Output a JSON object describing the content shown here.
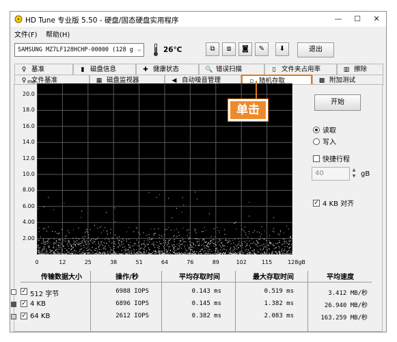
{
  "window": {
    "title": "HD Tune 专业版 5.50 - 硬盘/固态硬盘实用程序",
    "minimize": "—",
    "maximize": "☐",
    "close": "✕"
  },
  "menu": [
    {
      "label": "文件(F)"
    },
    {
      "label": "帮助(H)"
    }
  ],
  "toolbar": {
    "drive": "SAMSUNG MZ7LF128HCHP-00000 (128 g",
    "temperature": "26℃",
    "exit_label": "退出"
  },
  "tabs_top": [
    {
      "label": "基准",
      "icon": "♀"
    },
    {
      "label": "磁盘信息",
      "icon": "▮"
    },
    {
      "label": "健康状态",
      "icon": "✚"
    },
    {
      "label": "错误扫描",
      "icon": "🔍"
    },
    {
      "label": "文件夹占用率",
      "icon": "▯"
    },
    {
      "label": "擦除",
      "icon": "▥"
    }
  ],
  "tabs_bottom": [
    {
      "label": "文件基准",
      "icon": "♀"
    },
    {
      "label": "磁盘监视器",
      "icon": "▦"
    },
    {
      "label": "自动噪音管理",
      "icon": "◀"
    },
    {
      "label": "随机存取",
      "icon": "▫"
    },
    {
      "label": "附加测试",
      "icon": "▩"
    }
  ],
  "callout": "单击",
  "chart_data": {
    "type": "scatter",
    "ylabel": "ms",
    "y_ticks": [
      "20.0",
      "18.0",
      "16.0",
      "14.0",
      "12.0",
      "10.0",
      "8.00",
      "6.00",
      "4.00",
      "2.00"
    ],
    "x_ticks": [
      "0",
      "12",
      "25",
      "38",
      "51",
      "64",
      "76",
      "89",
      "102",
      "115",
      "128gB"
    ],
    "ylim": [
      0,
      20
    ],
    "xlim": [
      0,
      128
    ],
    "grid": true,
    "series": [
      {
        "values": "dense cluster of access times 0.1–2.0 ms, sparse points up to 8 ms",
        "color": "#ffffff"
      }
    ]
  },
  "controls": {
    "start_label": "开始",
    "read_label": "读取",
    "write_label": "写入",
    "read_selected": true,
    "quick_label": "快捷行程",
    "quick_checked": false,
    "quick_value": "40",
    "quick_unit": "gB",
    "align_label": "4 KB 对齐",
    "align_checked": true
  },
  "table": {
    "headers": [
      "传输数据大小",
      "操作/秒",
      "平均存取时间",
      "最大存取时间",
      "平均速度"
    ],
    "rows": [
      {
        "size": "512 字节",
        "iops": "6988 IOPS",
        "avg": "0.143 ms",
        "max": "0.519 ms",
        "speed": "3.412 MB/秒",
        "legend_color": "#ffffff"
      },
      {
        "size": "4 KB",
        "iops": "6896 IOPS",
        "avg": "0.145 ms",
        "max": "1.382 ms",
        "speed": "26.940 MB/秒",
        "legend_color": "#555555"
      },
      {
        "size": "64 KB",
        "iops": "2612 IOPS",
        "avg": "0.382 ms",
        "max": "2.083 ms",
        "speed": "163.259 MB/秒",
        "legend_color": "#cfcfcf"
      }
    ]
  },
  "colors": {
    "accent": "#e07a1a",
    "callout": "#ef8a2c",
    "plot_bg": "#000000",
    "grid": "#5a5a5a"
  }
}
